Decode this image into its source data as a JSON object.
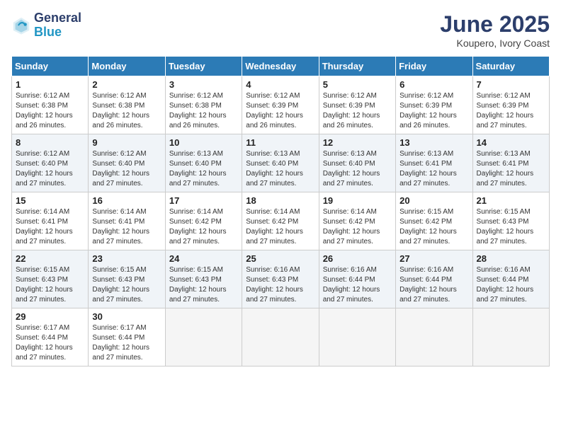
{
  "header": {
    "logo_general": "General",
    "logo_blue": "Blue",
    "month_title": "June 2025",
    "subtitle": "Koupero, Ivory Coast"
  },
  "weekdays": [
    "Sunday",
    "Monday",
    "Tuesday",
    "Wednesday",
    "Thursday",
    "Friday",
    "Saturday"
  ],
  "weeks": [
    [
      {
        "day": "1",
        "info": "Sunrise: 6:12 AM\nSunset: 6:38 PM\nDaylight: 12 hours\nand 26 minutes."
      },
      {
        "day": "2",
        "info": "Sunrise: 6:12 AM\nSunset: 6:38 PM\nDaylight: 12 hours\nand 26 minutes."
      },
      {
        "day": "3",
        "info": "Sunrise: 6:12 AM\nSunset: 6:38 PM\nDaylight: 12 hours\nand 26 minutes."
      },
      {
        "day": "4",
        "info": "Sunrise: 6:12 AM\nSunset: 6:39 PM\nDaylight: 12 hours\nand 26 minutes."
      },
      {
        "day": "5",
        "info": "Sunrise: 6:12 AM\nSunset: 6:39 PM\nDaylight: 12 hours\nand 26 minutes."
      },
      {
        "day": "6",
        "info": "Sunrise: 6:12 AM\nSunset: 6:39 PM\nDaylight: 12 hours\nand 26 minutes."
      },
      {
        "day": "7",
        "info": "Sunrise: 6:12 AM\nSunset: 6:39 PM\nDaylight: 12 hours\nand 27 minutes."
      }
    ],
    [
      {
        "day": "8",
        "info": "Sunrise: 6:12 AM\nSunset: 6:40 PM\nDaylight: 12 hours\nand 27 minutes."
      },
      {
        "day": "9",
        "info": "Sunrise: 6:12 AM\nSunset: 6:40 PM\nDaylight: 12 hours\nand 27 minutes."
      },
      {
        "day": "10",
        "info": "Sunrise: 6:13 AM\nSunset: 6:40 PM\nDaylight: 12 hours\nand 27 minutes."
      },
      {
        "day": "11",
        "info": "Sunrise: 6:13 AM\nSunset: 6:40 PM\nDaylight: 12 hours\nand 27 minutes."
      },
      {
        "day": "12",
        "info": "Sunrise: 6:13 AM\nSunset: 6:40 PM\nDaylight: 12 hours\nand 27 minutes."
      },
      {
        "day": "13",
        "info": "Sunrise: 6:13 AM\nSunset: 6:41 PM\nDaylight: 12 hours\nand 27 minutes."
      },
      {
        "day": "14",
        "info": "Sunrise: 6:13 AM\nSunset: 6:41 PM\nDaylight: 12 hours\nand 27 minutes."
      }
    ],
    [
      {
        "day": "15",
        "info": "Sunrise: 6:14 AM\nSunset: 6:41 PM\nDaylight: 12 hours\nand 27 minutes."
      },
      {
        "day": "16",
        "info": "Sunrise: 6:14 AM\nSunset: 6:41 PM\nDaylight: 12 hours\nand 27 minutes."
      },
      {
        "day": "17",
        "info": "Sunrise: 6:14 AM\nSunset: 6:42 PM\nDaylight: 12 hours\nand 27 minutes."
      },
      {
        "day": "18",
        "info": "Sunrise: 6:14 AM\nSunset: 6:42 PM\nDaylight: 12 hours\nand 27 minutes."
      },
      {
        "day": "19",
        "info": "Sunrise: 6:14 AM\nSunset: 6:42 PM\nDaylight: 12 hours\nand 27 minutes."
      },
      {
        "day": "20",
        "info": "Sunrise: 6:15 AM\nSunset: 6:42 PM\nDaylight: 12 hours\nand 27 minutes."
      },
      {
        "day": "21",
        "info": "Sunrise: 6:15 AM\nSunset: 6:43 PM\nDaylight: 12 hours\nand 27 minutes."
      }
    ],
    [
      {
        "day": "22",
        "info": "Sunrise: 6:15 AM\nSunset: 6:43 PM\nDaylight: 12 hours\nand 27 minutes."
      },
      {
        "day": "23",
        "info": "Sunrise: 6:15 AM\nSunset: 6:43 PM\nDaylight: 12 hours\nand 27 minutes."
      },
      {
        "day": "24",
        "info": "Sunrise: 6:15 AM\nSunset: 6:43 PM\nDaylight: 12 hours\nand 27 minutes."
      },
      {
        "day": "25",
        "info": "Sunrise: 6:16 AM\nSunset: 6:43 PM\nDaylight: 12 hours\nand 27 minutes."
      },
      {
        "day": "26",
        "info": "Sunrise: 6:16 AM\nSunset: 6:44 PM\nDaylight: 12 hours\nand 27 minutes."
      },
      {
        "day": "27",
        "info": "Sunrise: 6:16 AM\nSunset: 6:44 PM\nDaylight: 12 hours\nand 27 minutes."
      },
      {
        "day": "28",
        "info": "Sunrise: 6:16 AM\nSunset: 6:44 PM\nDaylight: 12 hours\nand 27 minutes."
      }
    ],
    [
      {
        "day": "29",
        "info": "Sunrise: 6:17 AM\nSunset: 6:44 PM\nDaylight: 12 hours\nand 27 minutes."
      },
      {
        "day": "30",
        "info": "Sunrise: 6:17 AM\nSunset: 6:44 PM\nDaylight: 12 hours\nand 27 minutes."
      },
      {
        "day": "",
        "info": ""
      },
      {
        "day": "",
        "info": ""
      },
      {
        "day": "",
        "info": ""
      },
      {
        "day": "",
        "info": ""
      },
      {
        "day": "",
        "info": ""
      }
    ]
  ]
}
